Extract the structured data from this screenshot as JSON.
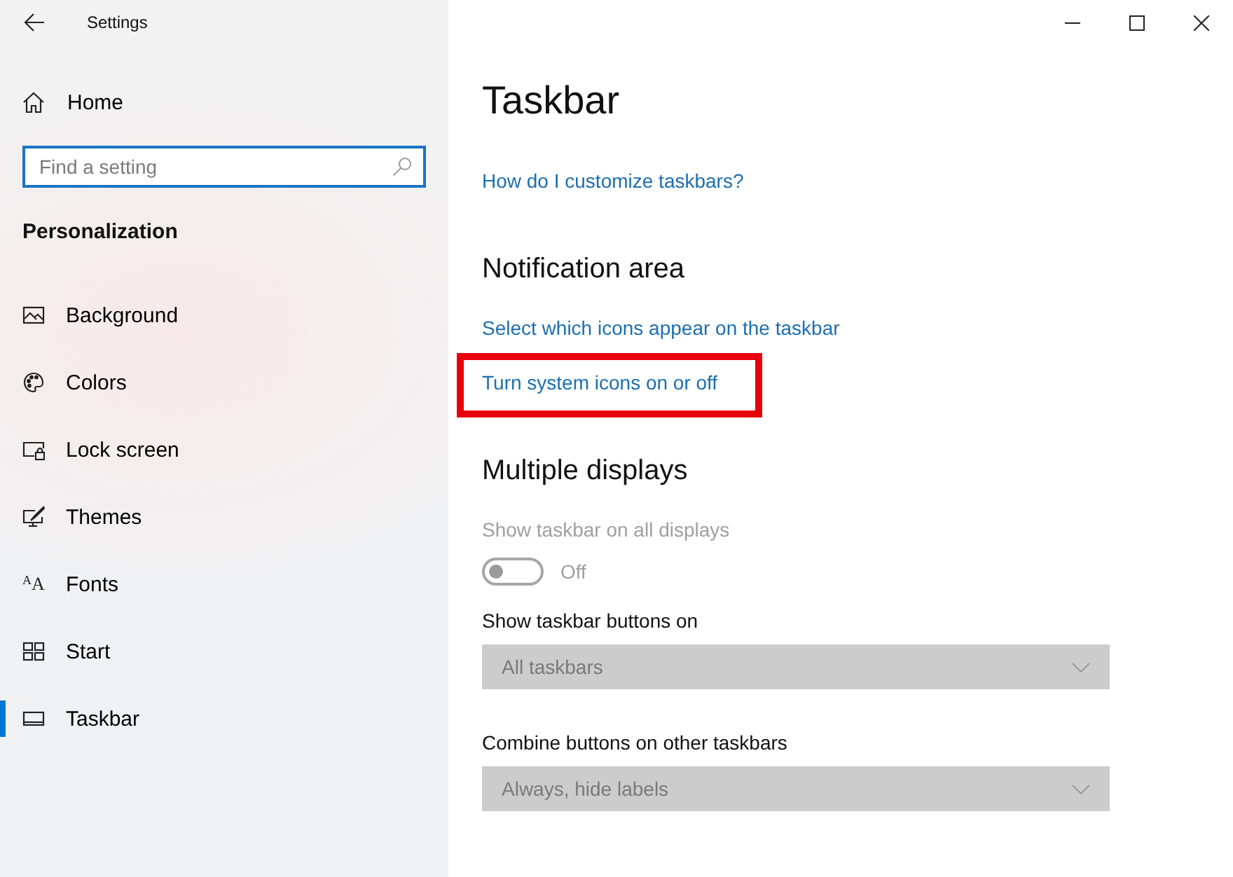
{
  "window": {
    "title": "Settings"
  },
  "sidebar": {
    "home": "Home",
    "search": {
      "placeholder": "Find a setting"
    },
    "section": "Personalization",
    "items": [
      {
        "kind": "background",
        "label": "Background",
        "selected": false
      },
      {
        "kind": "colors",
        "label": "Colors",
        "selected": false
      },
      {
        "kind": "lockscreen",
        "label": "Lock screen",
        "selected": false
      },
      {
        "kind": "themes",
        "label": "Themes",
        "selected": false
      },
      {
        "kind": "fonts",
        "icon_text": "$^{A}$A",
        "label": "Fonts",
        "selected": false
      },
      {
        "kind": "start",
        "label": "Start",
        "selected": false
      },
      {
        "kind": "taskbar",
        "label": "Taskbar",
        "selected": true
      }
    ]
  },
  "page": {
    "title": "Taskbar",
    "help_link": "How do I customize taskbars?",
    "sections": [
      {
        "heading": "Notification area",
        "links": [
          {
            "text": "Select which icons appear on the taskbar",
            "highlighted": false
          },
          {
            "text": "Turn system icons on or off",
            "highlighted": true
          }
        ]
      },
      {
        "heading": "Multiple displays",
        "settings": [
          {
            "kind": "toggle",
            "label": "Show taskbar on all displays",
            "on": false,
            "state_text": "Off",
            "disabled": true
          },
          {
            "kind": "dropdown",
            "label": "Show taskbar buttons on",
            "value": "All taskbars",
            "disabled": true
          },
          {
            "kind": "dropdown",
            "label": "Combine buttons on other taskbars",
            "value": "Always, hide labels",
            "disabled": true
          }
        ]
      }
    ]
  }
}
